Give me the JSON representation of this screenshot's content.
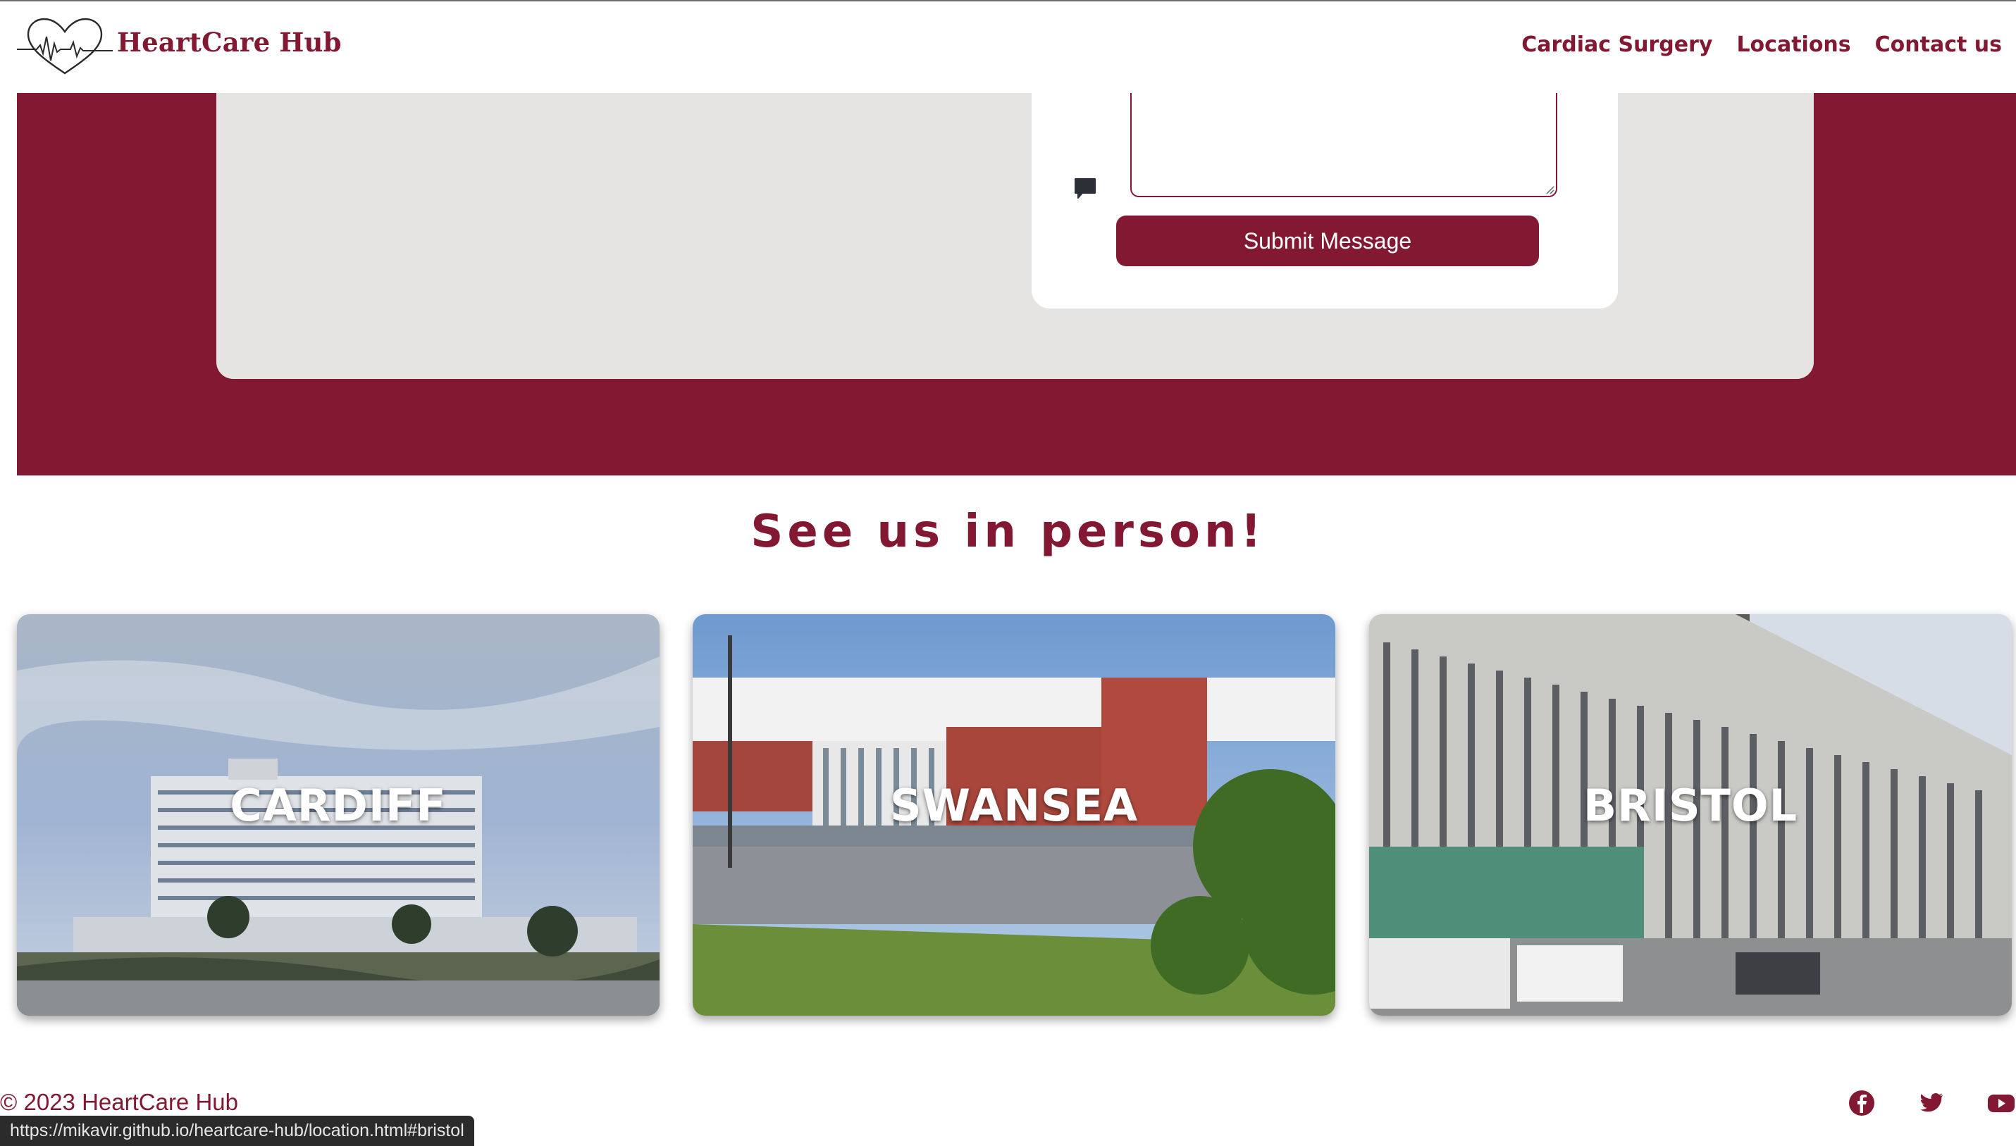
{
  "header": {
    "brand": "HeartCare Hub",
    "nav": [
      "Cardiac Surgery",
      "Locations",
      "Contact us"
    ]
  },
  "contact": {
    "submit_label": "Submit Message"
  },
  "locations": {
    "heading": "See us in person!",
    "cards": [
      {
        "name": "CARDIFF"
      },
      {
        "name": "SWANSEA"
      },
      {
        "name": "BRISTOL"
      }
    ]
  },
  "footer": {
    "copyright": "© 2023 HeartCare Hub",
    "social_icons": [
      "facebook-icon",
      "twitter-icon",
      "youtube-icon"
    ]
  },
  "browser": {
    "status_url": "https://mikavir.github.io/heartcare-hub/location.html#bristol"
  },
  "colors": {
    "brand": "#831832",
    "panel": "#e5e4e3"
  }
}
